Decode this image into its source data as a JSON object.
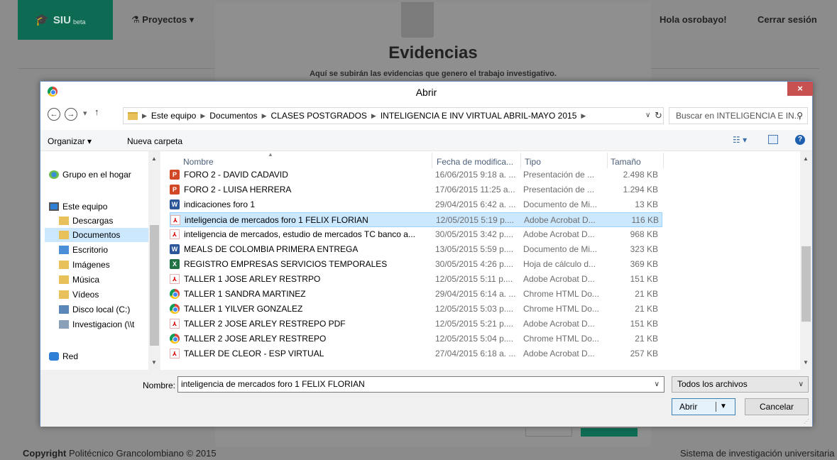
{
  "webapp": {
    "brand": "SIU",
    "brand_suffix": "beta",
    "nav_projects": "Proyectos",
    "greeting": "Hola osrobayo!",
    "logout": "Cerrar sesión",
    "modal_title": "Evidencias",
    "modal_subtitle": "Aquí se subirán las evidencias que genero el trabajo investigativo.",
    "footer_copyright_label": "Copyright",
    "footer_copyright_text": "Politécnico Grancolombiano © 2015",
    "footer_right": "Sistema de investigación universitaria"
  },
  "dialog": {
    "title": "Abrir",
    "close": "×",
    "breadcrumb": [
      "Este equipo",
      "Documentos",
      "CLASES POSTGRADOS",
      "INTELIGENCIA E INV VIRTUAL ABRIL-MAYO 2015"
    ],
    "search_placeholder": "Buscar en INTELIGENCIA E IN...",
    "toolbar": {
      "organize": "Organizar ▾",
      "new_folder": "Nueva carpeta"
    },
    "nav_pane": [
      {
        "label": "Grupo en el hogar",
        "icon": "homegroup-icon"
      },
      {
        "label": "Este equipo",
        "icon": "computer-icon"
      },
      {
        "label": "Descargas",
        "icon": "downloads-folder-icon"
      },
      {
        "label": "Documentos",
        "icon": "documents-folder-icon",
        "selected": true
      },
      {
        "label": "Escritorio",
        "icon": "desktop-folder-icon"
      },
      {
        "label": "Imágenes",
        "icon": "pictures-folder-icon"
      },
      {
        "label": "Música",
        "icon": "music-folder-icon"
      },
      {
        "label": "Vídeos",
        "icon": "videos-folder-icon"
      },
      {
        "label": "Disco local (C:)",
        "icon": "drive-icon"
      },
      {
        "label": "Investigacion (\\\\t",
        "icon": "network-drive-icon"
      },
      {
        "label": "Red",
        "icon": "network-icon"
      }
    ],
    "columns": {
      "name": "Nombre",
      "date": "Fecha de modifica...",
      "type": "Tipo",
      "size": "Tamaño"
    },
    "files": [
      {
        "name": "FORO 2 - DAVID CADAVID",
        "date": "16/06/2015 9:18 a. ...",
        "type": "Presentación de ...",
        "size": "2.498 KB",
        "icon": "ppt"
      },
      {
        "name": "FORO 2 - LUISA HERRERA",
        "date": "17/06/2015 11:25 a...",
        "type": "Presentación de ...",
        "size": "1.294 KB",
        "icon": "ppt"
      },
      {
        "name": "indicaciones foro 1",
        "date": "29/04/2015 6:42 a. ...",
        "type": "Documento de Mi...",
        "size": "13 KB",
        "icon": "doc"
      },
      {
        "name": "inteligencia de mercados foro 1 FELIX FLORIAN",
        "date": "12/05/2015 5:19 p....",
        "type": "Adobe Acrobat D...",
        "size": "116 KB",
        "icon": "pdf",
        "selected": true
      },
      {
        "name": "inteligencia de mercados, estudio de mercados TC banco a...",
        "date": "30/05/2015 3:42 p....",
        "type": "Adobe Acrobat D...",
        "size": "968 KB",
        "icon": "pdf"
      },
      {
        "name": "MEALS DE COLOMBIA PRIMERA ENTREGA",
        "date": "13/05/2015 5:59 p....",
        "type": "Documento de Mi...",
        "size": "323 KB",
        "icon": "doc"
      },
      {
        "name": "REGISTRO EMPRESAS SERVICIOS TEMPORALES",
        "date": "30/05/2015 4:26 p....",
        "type": "Hoja de cálculo d...",
        "size": "369 KB",
        "icon": "xls"
      },
      {
        "name": "TALLER 1 JOSE ARLEY RESTRPO",
        "date": "12/05/2015 5:11 p....",
        "type": "Adobe Acrobat D...",
        "size": "151 KB",
        "icon": "pdf"
      },
      {
        "name": "TALLER 1 SANDRA MARTINEZ",
        "date": "29/04/2015 6:14 a. ...",
        "type": "Chrome HTML Do...",
        "size": "21 KB",
        "icon": "chrome"
      },
      {
        "name": "TALLER 1 YILVER GONZALEZ",
        "date": "12/05/2015 5:03 p....",
        "type": "Chrome HTML Do...",
        "size": "21 KB",
        "icon": "chrome"
      },
      {
        "name": "TALLER 2 JOSE ARLEY RESTREPO PDF",
        "date": "12/05/2015 5:21 p....",
        "type": "Adobe Acrobat D...",
        "size": "151 KB",
        "icon": "pdf"
      },
      {
        "name": "TALLER 2 JOSE ARLEY RESTREPO",
        "date": "12/05/2015 5:04 p....",
        "type": "Chrome HTML Do...",
        "size": "21 KB",
        "icon": "chrome"
      },
      {
        "name": "TALLER DE CLEOR - ESP VIRTUAL",
        "date": "27/04/2015 6:18 a. ...",
        "type": "Adobe Acrobat D...",
        "size": "257 KB",
        "icon": "pdf"
      }
    ],
    "filename_label": "Nombre:",
    "filename_value": "inteligencia de mercados foro 1 FELIX FLORIAN",
    "filter": "Todos los archivos",
    "open_button": "Abrir",
    "cancel_button": "Cancelar"
  }
}
